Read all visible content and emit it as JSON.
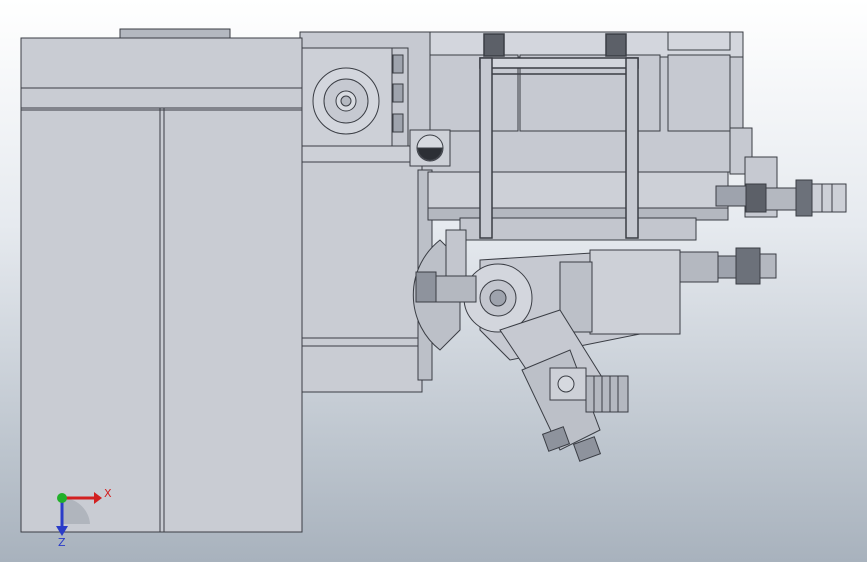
{
  "viewport": {
    "background_top": "#ffffff",
    "background_bottom": "#a8b2bd",
    "model_fill": "#c6c9d1",
    "model_fill_light": "#d3d6dd",
    "model_fill_dark": "#9ea3ad",
    "edge_color": "#3a3d44",
    "hole_color": "#2c2f35"
  },
  "triad": {
    "x_label": "X",
    "z_label": "Z",
    "x_color": "#d22020",
    "y_color": "#22b02a",
    "z_color": "#2a3cc8",
    "x_icon": "x-axis-arrow-icon",
    "z_icon": "z-axis-arrow-icon"
  }
}
